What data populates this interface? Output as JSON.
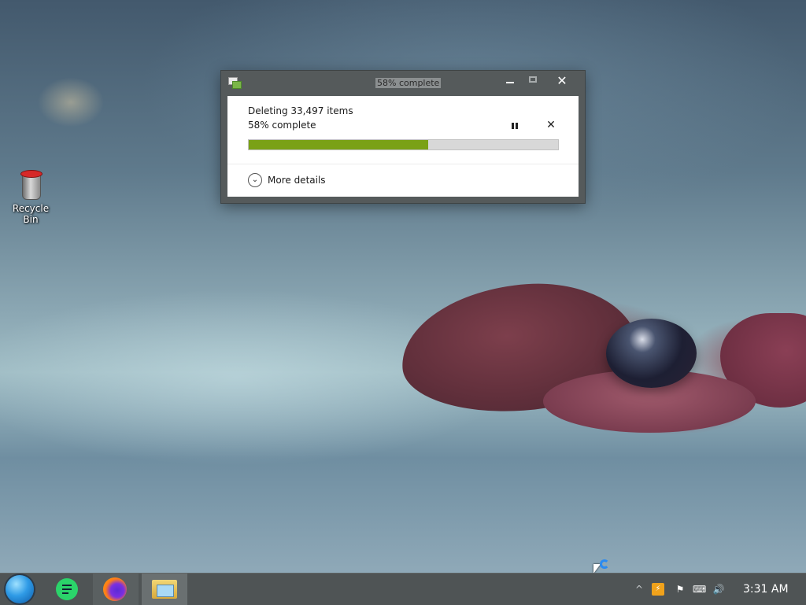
{
  "desktop": {
    "icons": [
      {
        "label": "Recycle Bin",
        "icon": "recycle-bin-icon"
      }
    ]
  },
  "dialog": {
    "title": "58% complete",
    "heading": "Deleting 33,497 items",
    "percent_text": "58% complete",
    "progress": 0.58,
    "progress_color": "#7aa116",
    "pause_glyph": "II",
    "cancel_glyph": "✕",
    "details_label": "More details",
    "controls": {
      "minimize": "minimize-icon",
      "maximize": "maximize-icon",
      "close_glyph": "✕"
    }
  },
  "taskbar": {
    "start": "start-orb-icon",
    "apps": [
      {
        "name": "notes",
        "icon": "notes-icon"
      },
      {
        "name": "firefox",
        "icon": "firefox-icon"
      },
      {
        "name": "files",
        "icon": "file-explorer-icon"
      }
    ],
    "tray": {
      "overflow_glyph": "^",
      "update_glyph": "⚡",
      "flag_glyph": "⚑",
      "network_glyph": "⌨",
      "volume_glyph": "🔊"
    },
    "clock": "3:31 AM"
  }
}
